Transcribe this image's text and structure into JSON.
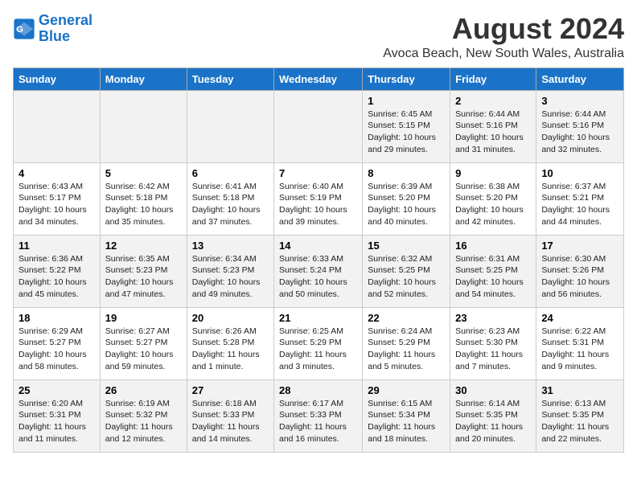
{
  "logo": {
    "line1": "General",
    "line2": "Blue"
  },
  "title": "August 2024",
  "location": "Avoca Beach, New South Wales, Australia",
  "days_of_week": [
    "Sunday",
    "Monday",
    "Tuesday",
    "Wednesday",
    "Thursday",
    "Friday",
    "Saturday"
  ],
  "weeks": [
    [
      {
        "day": "",
        "text": ""
      },
      {
        "day": "",
        "text": ""
      },
      {
        "day": "",
        "text": ""
      },
      {
        "day": "",
        "text": ""
      },
      {
        "day": "1",
        "text": "Sunrise: 6:45 AM\nSunset: 5:15 PM\nDaylight: 10 hours\nand 29 minutes."
      },
      {
        "day": "2",
        "text": "Sunrise: 6:44 AM\nSunset: 5:16 PM\nDaylight: 10 hours\nand 31 minutes."
      },
      {
        "day": "3",
        "text": "Sunrise: 6:44 AM\nSunset: 5:16 PM\nDaylight: 10 hours\nand 32 minutes."
      }
    ],
    [
      {
        "day": "4",
        "text": "Sunrise: 6:43 AM\nSunset: 5:17 PM\nDaylight: 10 hours\nand 34 minutes."
      },
      {
        "day": "5",
        "text": "Sunrise: 6:42 AM\nSunset: 5:18 PM\nDaylight: 10 hours\nand 35 minutes."
      },
      {
        "day": "6",
        "text": "Sunrise: 6:41 AM\nSunset: 5:18 PM\nDaylight: 10 hours\nand 37 minutes."
      },
      {
        "day": "7",
        "text": "Sunrise: 6:40 AM\nSunset: 5:19 PM\nDaylight: 10 hours\nand 39 minutes."
      },
      {
        "day": "8",
        "text": "Sunrise: 6:39 AM\nSunset: 5:20 PM\nDaylight: 10 hours\nand 40 minutes."
      },
      {
        "day": "9",
        "text": "Sunrise: 6:38 AM\nSunset: 5:20 PM\nDaylight: 10 hours\nand 42 minutes."
      },
      {
        "day": "10",
        "text": "Sunrise: 6:37 AM\nSunset: 5:21 PM\nDaylight: 10 hours\nand 44 minutes."
      }
    ],
    [
      {
        "day": "11",
        "text": "Sunrise: 6:36 AM\nSunset: 5:22 PM\nDaylight: 10 hours\nand 45 minutes."
      },
      {
        "day": "12",
        "text": "Sunrise: 6:35 AM\nSunset: 5:23 PM\nDaylight: 10 hours\nand 47 minutes."
      },
      {
        "day": "13",
        "text": "Sunrise: 6:34 AM\nSunset: 5:23 PM\nDaylight: 10 hours\nand 49 minutes."
      },
      {
        "day": "14",
        "text": "Sunrise: 6:33 AM\nSunset: 5:24 PM\nDaylight: 10 hours\nand 50 minutes."
      },
      {
        "day": "15",
        "text": "Sunrise: 6:32 AM\nSunset: 5:25 PM\nDaylight: 10 hours\nand 52 minutes."
      },
      {
        "day": "16",
        "text": "Sunrise: 6:31 AM\nSunset: 5:25 PM\nDaylight: 10 hours\nand 54 minutes."
      },
      {
        "day": "17",
        "text": "Sunrise: 6:30 AM\nSunset: 5:26 PM\nDaylight: 10 hours\nand 56 minutes."
      }
    ],
    [
      {
        "day": "18",
        "text": "Sunrise: 6:29 AM\nSunset: 5:27 PM\nDaylight: 10 hours\nand 58 minutes."
      },
      {
        "day": "19",
        "text": "Sunrise: 6:27 AM\nSunset: 5:27 PM\nDaylight: 10 hours\nand 59 minutes."
      },
      {
        "day": "20",
        "text": "Sunrise: 6:26 AM\nSunset: 5:28 PM\nDaylight: 11 hours\nand 1 minute."
      },
      {
        "day": "21",
        "text": "Sunrise: 6:25 AM\nSunset: 5:29 PM\nDaylight: 11 hours\nand 3 minutes."
      },
      {
        "day": "22",
        "text": "Sunrise: 6:24 AM\nSunset: 5:29 PM\nDaylight: 11 hours\nand 5 minutes."
      },
      {
        "day": "23",
        "text": "Sunrise: 6:23 AM\nSunset: 5:30 PM\nDaylight: 11 hours\nand 7 minutes."
      },
      {
        "day": "24",
        "text": "Sunrise: 6:22 AM\nSunset: 5:31 PM\nDaylight: 11 hours\nand 9 minutes."
      }
    ],
    [
      {
        "day": "25",
        "text": "Sunrise: 6:20 AM\nSunset: 5:31 PM\nDaylight: 11 hours\nand 11 minutes."
      },
      {
        "day": "26",
        "text": "Sunrise: 6:19 AM\nSunset: 5:32 PM\nDaylight: 11 hours\nand 12 minutes."
      },
      {
        "day": "27",
        "text": "Sunrise: 6:18 AM\nSunset: 5:33 PM\nDaylight: 11 hours\nand 14 minutes."
      },
      {
        "day": "28",
        "text": "Sunrise: 6:17 AM\nSunset: 5:33 PM\nDaylight: 11 hours\nand 16 minutes."
      },
      {
        "day": "29",
        "text": "Sunrise: 6:15 AM\nSunset: 5:34 PM\nDaylight: 11 hours\nand 18 minutes."
      },
      {
        "day": "30",
        "text": "Sunrise: 6:14 AM\nSunset: 5:35 PM\nDaylight: 11 hours\nand 20 minutes."
      },
      {
        "day": "31",
        "text": "Sunrise: 6:13 AM\nSunset: 5:35 PM\nDaylight: 11 hours\nand 22 minutes."
      }
    ]
  ]
}
